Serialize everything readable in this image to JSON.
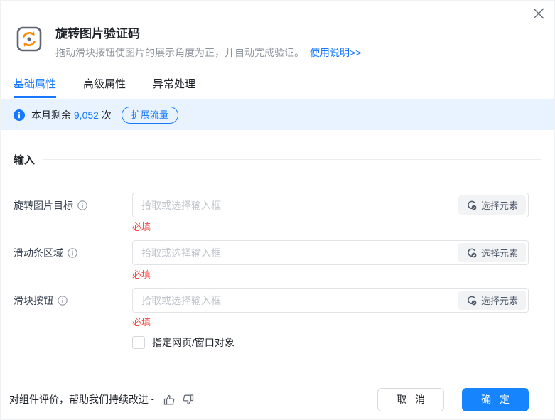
{
  "dialog": {
    "title": "旋转图片验证码",
    "description": "拖动滑块按钮使图片的展示角度为正，并自动完成验证。",
    "help_link": "使用说明>>"
  },
  "tabs": [
    {
      "label": "基础属性",
      "active": true
    },
    {
      "label": "高级属性",
      "active": false
    },
    {
      "label": "异常处理",
      "active": false
    }
  ],
  "quota": {
    "prefix": "本月剩余",
    "count": "9,052",
    "unit": "次",
    "expand_label": "扩展流量"
  },
  "section": {
    "title": "输入"
  },
  "fields": [
    {
      "label": "旋转图片目标",
      "placeholder": "拾取或选择输入框",
      "select_label": "选择元素",
      "required_text": "必填"
    },
    {
      "label": "滑动条区域",
      "placeholder": "拾取或选择输入框",
      "select_label": "选择元素",
      "required_text": "必填"
    },
    {
      "label": "滑块按钮",
      "placeholder": "拾取或选择输入框",
      "select_label": "选择元素",
      "required_text": "必填"
    }
  ],
  "checkbox": {
    "label": "指定网页/窗口对象",
    "checked": false
  },
  "footer": {
    "feedback_text": "对组件评价，帮助我们持续改进~",
    "cancel_label": "取 消",
    "confirm_label": "确 定"
  },
  "colors": {
    "accent_blue": "#1678ff",
    "confirm_button": "#1684fc",
    "quota_bar_bg": "#e8f3ff",
    "required_red": "#f54a45",
    "icon_orange": "#ff8800",
    "placeholder_gray": "#c1c5cd"
  }
}
